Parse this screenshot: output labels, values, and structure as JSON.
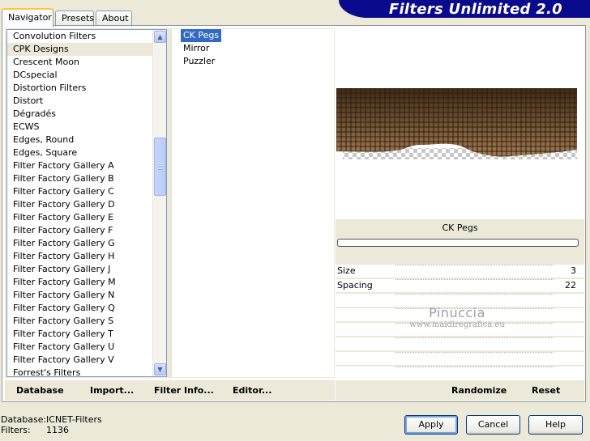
{
  "app": {
    "banner_title": "Filters Unlimited 2.0"
  },
  "tabs": [
    {
      "label": "Navigator",
      "active": true
    },
    {
      "label": "Presets",
      "active": false
    },
    {
      "label": "About",
      "active": false
    }
  ],
  "categories": {
    "selected": "CPK Designs",
    "items": [
      "Convolution Filters",
      "CPK Designs",
      "Crescent Moon",
      "DCspecial",
      "Distortion Filters",
      "Distort",
      "Dégradés",
      "ECWS",
      "Edges, Round",
      "Edges, Square",
      "Filter Factory Gallery A",
      "Filter Factory Gallery B",
      "Filter Factory Gallery C",
      "Filter Factory Gallery D",
      "Filter Factory Gallery E",
      "Filter Factory Gallery F",
      "Filter Factory Gallery G",
      "Filter Factory Gallery H",
      "Filter Factory Gallery J",
      "Filter Factory Gallery M",
      "Filter Factory Gallery N",
      "Filter Factory Gallery Q",
      "Filter Factory Gallery S",
      "Filter Factory Gallery T",
      "Filter Factory Gallery U",
      "Filter Factory Gallery V",
      "Forrest's Filters"
    ]
  },
  "filters": {
    "selected": "CK Pegs",
    "items": [
      "CK Pegs",
      "Mirror",
      "Puzzler"
    ]
  },
  "left_toolbar": {
    "database": "Database",
    "import": "Import...",
    "filter_info": "Filter Info...",
    "editor": "Editor..."
  },
  "preview": {
    "filter_name": "CK Pegs",
    "progress": 0,
    "colors": {
      "dark": "#3f2a16",
      "light": "#a07a52",
      "grid": "#2a1a0c"
    }
  },
  "params": [
    {
      "label": "Size",
      "value": "3"
    },
    {
      "label": "Spacing",
      "value": "22"
    },
    {
      "label": "",
      "value": ""
    },
    {
      "label": "",
      "value": ""
    },
    {
      "label": "",
      "value": ""
    },
    {
      "label": "",
      "value": ""
    },
    {
      "label": "",
      "value": ""
    },
    {
      "label": "",
      "value": ""
    }
  ],
  "watermark": {
    "name": "Pinuccia",
    "url": "www.maidiregrafica.eu"
  },
  "right_toolbar": {
    "randomize": "Randomize",
    "reset": "Reset"
  },
  "footer": {
    "database_key": "Database:",
    "database_value": "ICNET-Filters",
    "filters_key": "Filters:",
    "filters_value": "1136"
  },
  "buttons": {
    "apply": "Apply",
    "cancel": "Cancel",
    "help": "Help"
  }
}
